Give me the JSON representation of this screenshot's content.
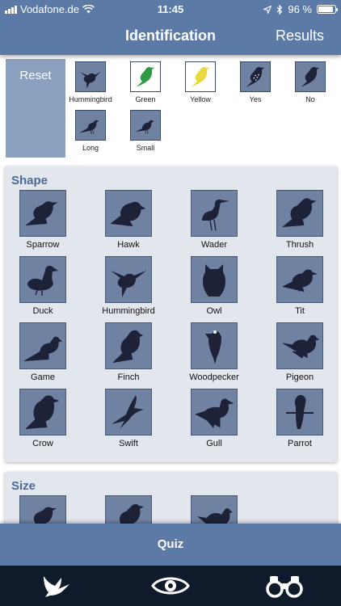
{
  "status_bar": {
    "carrier": "Vodafone.de",
    "time": "11:45",
    "battery": "96 %"
  },
  "header": {
    "title": "Identification",
    "results_label": "Results"
  },
  "filters": {
    "reset_label": "Reset",
    "items": [
      {
        "label": "Hummingbird",
        "icon": "hummingbird-icon"
      },
      {
        "label": "Green",
        "icon": "green-bird-icon",
        "color": "#2f9a45"
      },
      {
        "label": "Yellow",
        "icon": "yellow-bird-icon",
        "color": "#e8d83a"
      },
      {
        "label": "Yes",
        "icon": "spotted-bird-icon"
      },
      {
        "label": "No",
        "icon": "plain-bird-icon"
      },
      {
        "label": "Long",
        "icon": "long-tail-bird-icon"
      },
      {
        "label": "Small",
        "icon": "small-bird-icon"
      }
    ]
  },
  "shape": {
    "title": "Shape",
    "items": [
      {
        "label": "Sparrow",
        "icon": "sparrow-icon"
      },
      {
        "label": "Hawk",
        "icon": "hawk-icon"
      },
      {
        "label": "Wader",
        "icon": "wader-icon"
      },
      {
        "label": "Thrush",
        "icon": "thrush-icon"
      },
      {
        "label": "Duck",
        "icon": "duck-icon"
      },
      {
        "label": "Hummingbird",
        "icon": "hummingbird-icon"
      },
      {
        "label": "Owl",
        "icon": "owl-icon"
      },
      {
        "label": "Tit",
        "icon": "tit-icon"
      },
      {
        "label": "Game",
        "icon": "game-bird-icon"
      },
      {
        "label": "Finch",
        "icon": "finch-icon"
      },
      {
        "label": "Woodpecker",
        "icon": "woodpecker-icon"
      },
      {
        "label": "Pigeon",
        "icon": "pigeon-icon"
      },
      {
        "label": "Crow",
        "icon": "crow-icon"
      },
      {
        "label": "Swift",
        "icon": "swift-icon"
      },
      {
        "label": "Gull",
        "icon": "gull-icon"
      },
      {
        "label": "Parrot",
        "icon": "parrot-icon"
      }
    ]
  },
  "size": {
    "title": "Size"
  },
  "quiz_label": "Quiz",
  "tab_bar": {
    "items": [
      {
        "icon": "bird-flying-icon"
      },
      {
        "icon": "eye-icon"
      },
      {
        "icon": "binoculars-icon"
      }
    ]
  },
  "colors": {
    "accent": "#5b7aa6",
    "tile": "#6f82a2",
    "silhouette": "#1e2238",
    "tab_bar": "#0f1a2a"
  }
}
